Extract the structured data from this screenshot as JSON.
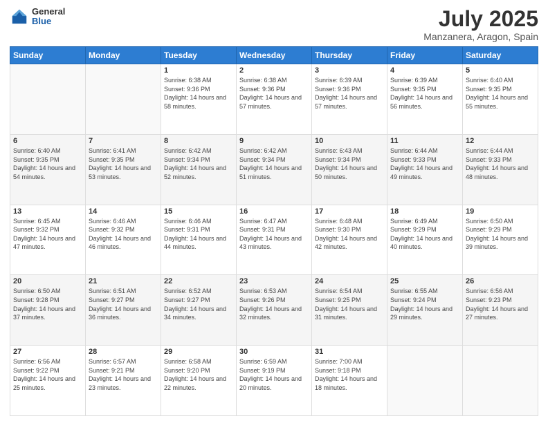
{
  "logo": {
    "general": "General",
    "blue": "Blue"
  },
  "header": {
    "title": "July 2025",
    "subtitle": "Manzanera, Aragon, Spain"
  },
  "days_of_week": [
    "Sunday",
    "Monday",
    "Tuesday",
    "Wednesday",
    "Thursday",
    "Friday",
    "Saturday"
  ],
  "weeks": [
    [
      {
        "day": "",
        "info": ""
      },
      {
        "day": "",
        "info": ""
      },
      {
        "day": "1",
        "info": "Sunrise: 6:38 AM\nSunset: 9:36 PM\nDaylight: 14 hours and 58 minutes."
      },
      {
        "day": "2",
        "info": "Sunrise: 6:38 AM\nSunset: 9:36 PM\nDaylight: 14 hours and 57 minutes."
      },
      {
        "day": "3",
        "info": "Sunrise: 6:39 AM\nSunset: 9:36 PM\nDaylight: 14 hours and 57 minutes."
      },
      {
        "day": "4",
        "info": "Sunrise: 6:39 AM\nSunset: 9:35 PM\nDaylight: 14 hours and 56 minutes."
      },
      {
        "day": "5",
        "info": "Sunrise: 6:40 AM\nSunset: 9:35 PM\nDaylight: 14 hours and 55 minutes."
      }
    ],
    [
      {
        "day": "6",
        "info": "Sunrise: 6:40 AM\nSunset: 9:35 PM\nDaylight: 14 hours and 54 minutes."
      },
      {
        "day": "7",
        "info": "Sunrise: 6:41 AM\nSunset: 9:35 PM\nDaylight: 14 hours and 53 minutes."
      },
      {
        "day": "8",
        "info": "Sunrise: 6:42 AM\nSunset: 9:34 PM\nDaylight: 14 hours and 52 minutes."
      },
      {
        "day": "9",
        "info": "Sunrise: 6:42 AM\nSunset: 9:34 PM\nDaylight: 14 hours and 51 minutes."
      },
      {
        "day": "10",
        "info": "Sunrise: 6:43 AM\nSunset: 9:34 PM\nDaylight: 14 hours and 50 minutes."
      },
      {
        "day": "11",
        "info": "Sunrise: 6:44 AM\nSunset: 9:33 PM\nDaylight: 14 hours and 49 minutes."
      },
      {
        "day": "12",
        "info": "Sunrise: 6:44 AM\nSunset: 9:33 PM\nDaylight: 14 hours and 48 minutes."
      }
    ],
    [
      {
        "day": "13",
        "info": "Sunrise: 6:45 AM\nSunset: 9:32 PM\nDaylight: 14 hours and 47 minutes."
      },
      {
        "day": "14",
        "info": "Sunrise: 6:46 AM\nSunset: 9:32 PM\nDaylight: 14 hours and 46 minutes."
      },
      {
        "day": "15",
        "info": "Sunrise: 6:46 AM\nSunset: 9:31 PM\nDaylight: 14 hours and 44 minutes."
      },
      {
        "day": "16",
        "info": "Sunrise: 6:47 AM\nSunset: 9:31 PM\nDaylight: 14 hours and 43 minutes."
      },
      {
        "day": "17",
        "info": "Sunrise: 6:48 AM\nSunset: 9:30 PM\nDaylight: 14 hours and 42 minutes."
      },
      {
        "day": "18",
        "info": "Sunrise: 6:49 AM\nSunset: 9:29 PM\nDaylight: 14 hours and 40 minutes."
      },
      {
        "day": "19",
        "info": "Sunrise: 6:50 AM\nSunset: 9:29 PM\nDaylight: 14 hours and 39 minutes."
      }
    ],
    [
      {
        "day": "20",
        "info": "Sunrise: 6:50 AM\nSunset: 9:28 PM\nDaylight: 14 hours and 37 minutes."
      },
      {
        "day": "21",
        "info": "Sunrise: 6:51 AM\nSunset: 9:27 PM\nDaylight: 14 hours and 36 minutes."
      },
      {
        "day": "22",
        "info": "Sunrise: 6:52 AM\nSunset: 9:27 PM\nDaylight: 14 hours and 34 minutes."
      },
      {
        "day": "23",
        "info": "Sunrise: 6:53 AM\nSunset: 9:26 PM\nDaylight: 14 hours and 32 minutes."
      },
      {
        "day": "24",
        "info": "Sunrise: 6:54 AM\nSunset: 9:25 PM\nDaylight: 14 hours and 31 minutes."
      },
      {
        "day": "25",
        "info": "Sunrise: 6:55 AM\nSunset: 9:24 PM\nDaylight: 14 hours and 29 minutes."
      },
      {
        "day": "26",
        "info": "Sunrise: 6:56 AM\nSunset: 9:23 PM\nDaylight: 14 hours and 27 minutes."
      }
    ],
    [
      {
        "day": "27",
        "info": "Sunrise: 6:56 AM\nSunset: 9:22 PM\nDaylight: 14 hours and 25 minutes."
      },
      {
        "day": "28",
        "info": "Sunrise: 6:57 AM\nSunset: 9:21 PM\nDaylight: 14 hours and 23 minutes."
      },
      {
        "day": "29",
        "info": "Sunrise: 6:58 AM\nSunset: 9:20 PM\nDaylight: 14 hours and 22 minutes."
      },
      {
        "day": "30",
        "info": "Sunrise: 6:59 AM\nSunset: 9:19 PM\nDaylight: 14 hours and 20 minutes."
      },
      {
        "day": "31",
        "info": "Sunrise: 7:00 AM\nSunset: 9:18 PM\nDaylight: 14 hours and 18 minutes."
      },
      {
        "day": "",
        "info": ""
      },
      {
        "day": "",
        "info": ""
      }
    ]
  ]
}
